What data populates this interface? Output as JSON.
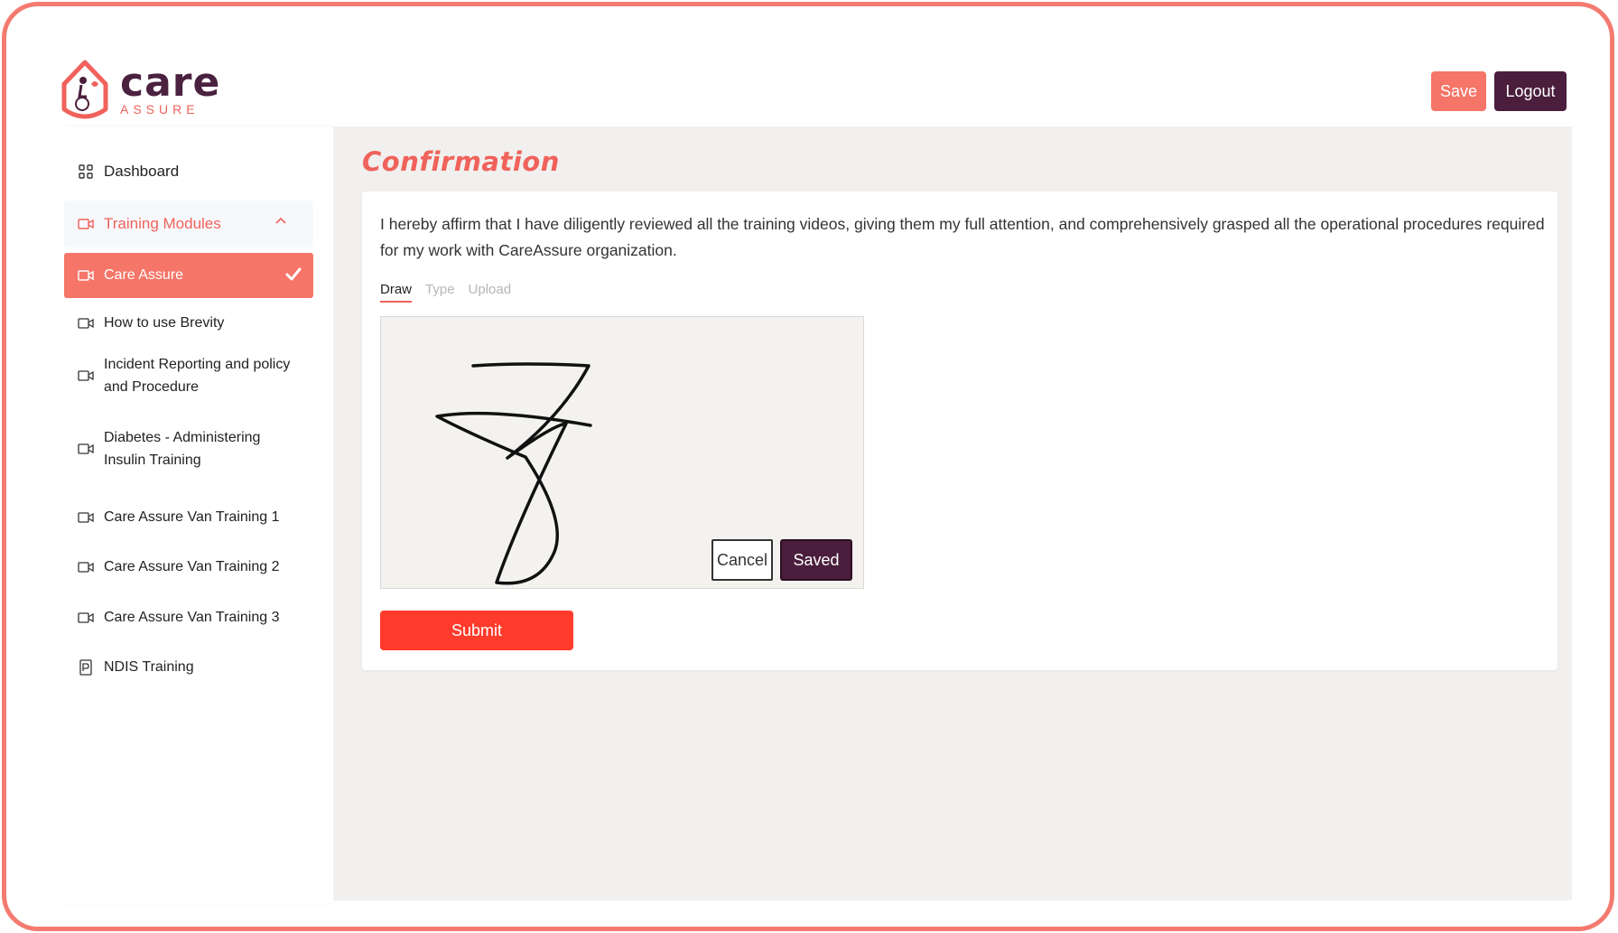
{
  "brand": {
    "name": "care",
    "tagline": "ASSURE"
  },
  "header": {
    "save_label": "Save",
    "logout_label": "Logout"
  },
  "sidebar": {
    "items": [
      {
        "label": "Dashboard",
        "icon": "grid-icon"
      },
      {
        "label": "Training Modules",
        "icon": "video-icon"
      },
      {
        "label": "Care Assure",
        "icon": "video-icon"
      },
      {
        "label": "How to use Brevity",
        "icon": "video-icon"
      },
      {
        "label": "Incident Reporting and policy and Procedure",
        "icon": "video-icon"
      },
      {
        "label": "Diabetes - Administering Insulin Training",
        "icon": "video-icon"
      },
      {
        "label": "Care Assure Van Training 1",
        "icon": "video-icon"
      },
      {
        "label": "Care Assure Van Training 2",
        "icon": "video-icon"
      },
      {
        "label": "Care Assure Van Training 3",
        "icon": "video-icon"
      },
      {
        "label": "NDIS Training",
        "icon": "document-icon"
      }
    ]
  },
  "main": {
    "title": "Confirmation",
    "affirmation": "I hereby affirm that I have diligently reviewed all the training videos, giving them my full attention, and comprehensively grasped all the operational procedures required for my work with CareAssure organization.",
    "tabs": [
      "Draw",
      "Type",
      "Upload"
    ],
    "cancel_label": "Cancel",
    "saved_label": "Saved",
    "submit_label": "Submit"
  },
  "colors": {
    "accent": "#f57568",
    "brand_dark": "#4a1e3c",
    "submit": "#ff3b2c",
    "border": "#f47a6f"
  }
}
